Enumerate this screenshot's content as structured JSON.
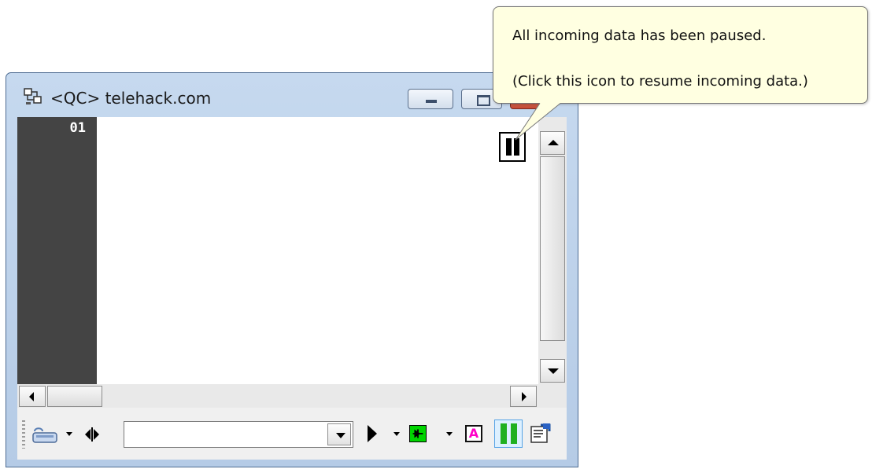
{
  "window": {
    "title": "<QC> telehack.com"
  },
  "terminal": {
    "line_number": "01"
  },
  "tooltip": {
    "line1": "All incoming data has been paused.",
    "line2": "(Click this icon to resume incoming data.)"
  },
  "toolbar": {
    "input_value": "",
    "a_button_label": "A"
  },
  "colors": {
    "gutter": "#444444",
    "tooltip_bg": "#ffffe1",
    "capture_button": "#00d400",
    "a_label": "#ff00c8",
    "pause_toolbar": "#20b020"
  },
  "icons": [
    "app-icon",
    "minimize-icon",
    "maximize-icon",
    "close-icon",
    "pause-icon",
    "keyboard-icon",
    "play-icon",
    "capture-icon",
    "font-icon",
    "pause-toggle-icon",
    "properties-icon"
  ]
}
